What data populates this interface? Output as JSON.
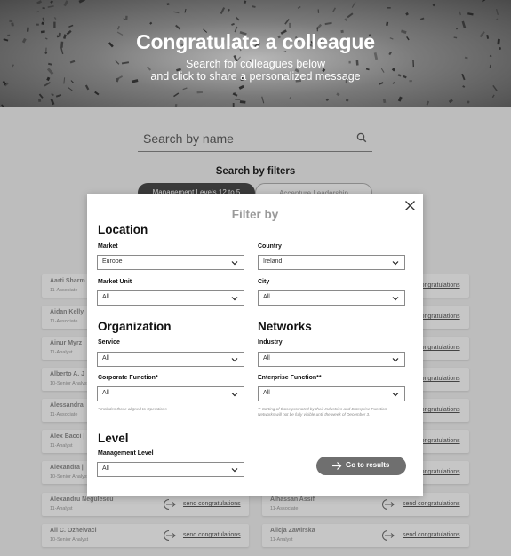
{
  "hero": {
    "title": "Congratulate a colleague",
    "subtitle_line1": "Search for colleagues below",
    "subtitle_line2": "and click to share a personalized message"
  },
  "search": {
    "placeholder": "Search by name",
    "icon": "search-icon"
  },
  "filters": {
    "title": "Search by filters",
    "tabs": [
      "Management Levels 12 to 5",
      "Accenture Leadership"
    ]
  },
  "people": {
    "send_label": "send congratulations",
    "left": [
      {
        "name": "Aarti Sharm",
        "role": "11-Associate"
      },
      {
        "name": "Aidan Kelly",
        "role": "11-Associate"
      },
      {
        "name": "Ainur Myrz",
        "role": "11-Analyst"
      },
      {
        "name": "Alberto A. J",
        "role": "10-Senior Analyst"
      },
      {
        "name": "Alessandra",
        "role": "11-Associate"
      },
      {
        "name": "Alex Bacci |",
        "role": "11-Analyst"
      },
      {
        "name": "Alexandra |",
        "role": "10-Senior Analyst"
      },
      {
        "name": "Alexandru Negulescu",
        "role": "11-Analyst"
      },
      {
        "name": "Ali C. Ozhelvaci",
        "role": "10-Senior Analyst"
      }
    ],
    "right": [
      {
        "name": "Alhassan Assif",
        "role": "11-Associate"
      },
      {
        "name": "Alicja Zawirska",
        "role": "11-Analyst"
      }
    ]
  },
  "modal": {
    "title": "Filter by",
    "sections": {
      "location": "Location",
      "organization": "Organization",
      "networks": "Networks",
      "level": "Level"
    },
    "fields": {
      "market": {
        "label": "Market",
        "value": "Europe"
      },
      "country": {
        "label": "Country",
        "value": "Ireland"
      },
      "market_unit": {
        "label": "Market Unit",
        "value": "All"
      },
      "city": {
        "label": "City",
        "value": "All"
      },
      "service": {
        "label": "Service",
        "value": "All"
      },
      "industry": {
        "label": "Industry",
        "value": "All"
      },
      "corporate_function": {
        "label": "Corporate Function*",
        "value": "All"
      },
      "enterprise_function": {
        "label": "Enterprise Function**",
        "value": "All"
      },
      "management_level": {
        "label": "Management Level",
        "value": "All"
      }
    },
    "note_corporate": "* Includes those aligned to Operations",
    "note_enterprise": "** Sorting of those promoted by their Industries and Enterprise Function Networks will not be fully visible until the week of December 3.",
    "go_label": "Go to results",
    "close_icon": "close-icon"
  },
  "colors": {
    "overlay": "#bdbdbd",
    "modal": "#ffffff",
    "button": "#6f6f6f"
  }
}
